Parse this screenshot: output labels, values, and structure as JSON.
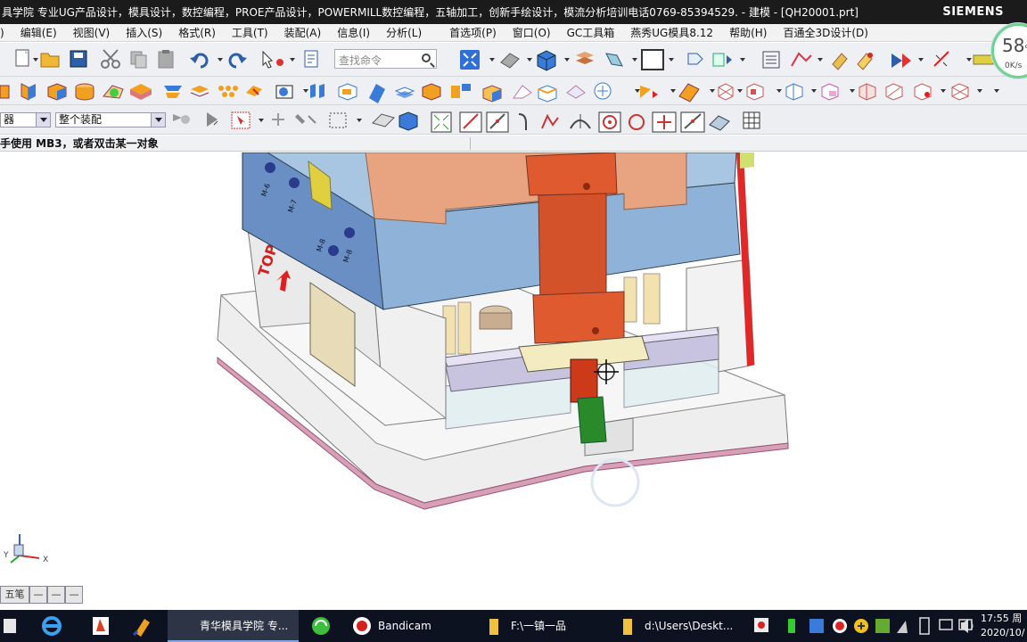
{
  "window": {
    "title": "具学院 专业UG产品设计，模具设计，数控编程，PROE产品设计，POWERMILL数控编程，五轴加工，创新手绘设计，模流分析培训电话0769-85394529. - 建模 - [QH20001.prt]",
    "brand": "SIEMENS"
  },
  "menu": [
    "编辑(E)",
    "视图(V)",
    "插入(S)",
    "格式(R)",
    "工具(T)",
    "装配(A)",
    "信息(I)",
    "分析(L)",
    "首选项(P)",
    "窗口(O)",
    "GC工具箱",
    "燕秀UG模具8.12",
    "帮助(H)",
    "百通全3D设计(D)"
  ],
  "menu_edge": ")",
  "search": {
    "placeholder": "查找命令"
  },
  "selection": {
    "filter_value": "器",
    "assembly_value": "整个装配"
  },
  "cue": "手使用 MB3，或者双击某一对象",
  "network": {
    "speed": "58",
    "unit": "%",
    "rate": "0K/s"
  },
  "graphics": {
    "part_label_top": "TOP",
    "hole_labels": [
      "M-6",
      "M-7",
      "M-8",
      "M-8"
    ],
    "triad": {
      "x": "X",
      "y": "Y"
    }
  },
  "ime": [
    "五笔",
    "—",
    "—",
    "—"
  ],
  "taskbar": {
    "items": [
      {
        "label": "青华模具学院 专...",
        "active": true
      },
      {
        "label": "",
        "active": false
      },
      {
        "label": "Bandicam",
        "active": false
      },
      {
        "label": "F:\\一镇一品",
        "active": false
      },
      {
        "label": "d:\\Users\\Deskt...",
        "active": false
      }
    ],
    "time": "17:55 周",
    "date": "2020/10/"
  }
}
